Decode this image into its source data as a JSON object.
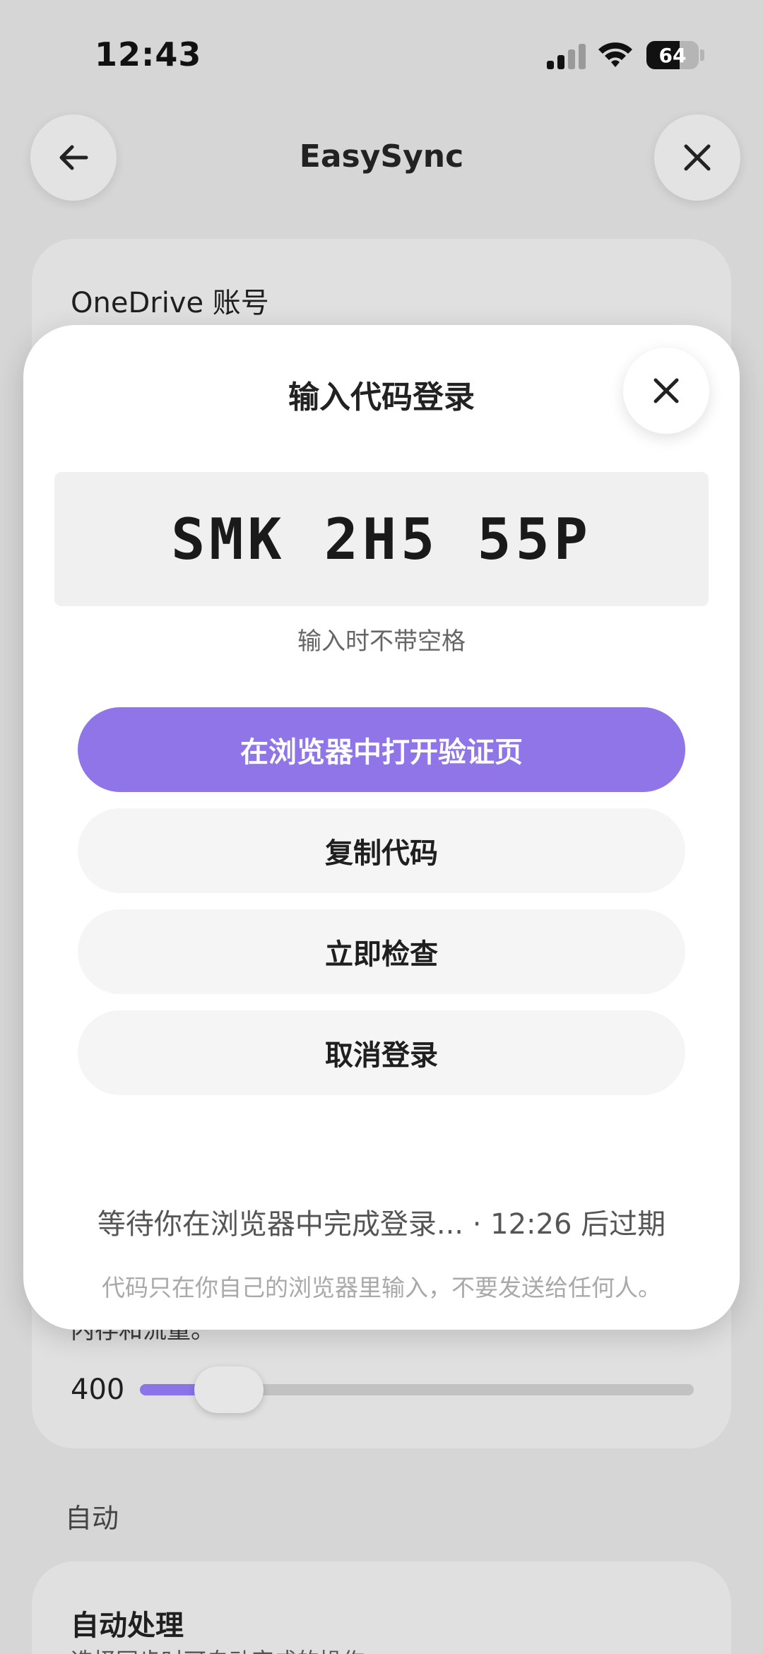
{
  "status_bar": {
    "time": "12:43",
    "battery": "64",
    "battery_level": 0.64,
    "icons": [
      "signal-icon",
      "wifi-icon",
      "battery-icon"
    ]
  },
  "nav": {
    "title": "EasySync",
    "back_icon": "arrow-left-icon",
    "close_icon": "close-icon"
  },
  "background": {
    "account_label": "OneDrive 账号",
    "traffic_label": "内存和流量。",
    "slider_value": "400",
    "slider_level": 0.13,
    "section_auto": "自动",
    "auto_title": "自动处理",
    "auto_desc": "选择同步时可自动完成的操作"
  },
  "dialog": {
    "title": "输入代码登录",
    "code": "SMK 2H5 55P",
    "hint": "输入时不带空格",
    "open_browser": "在浏览器中打开验证页",
    "copy_code": "复制代码",
    "check_now": "立即检查",
    "cancel_login": "取消登录",
    "waiting": "等待你在浏览器中完成登录... · 12:26 后过期",
    "warning": "代码只在你自己的浏览器里输入，不要发送给任何人。"
  },
  "colors": {
    "accent": "#8f75e8",
    "background": "#d6d6d6",
    "sheet": "#ffffff"
  }
}
